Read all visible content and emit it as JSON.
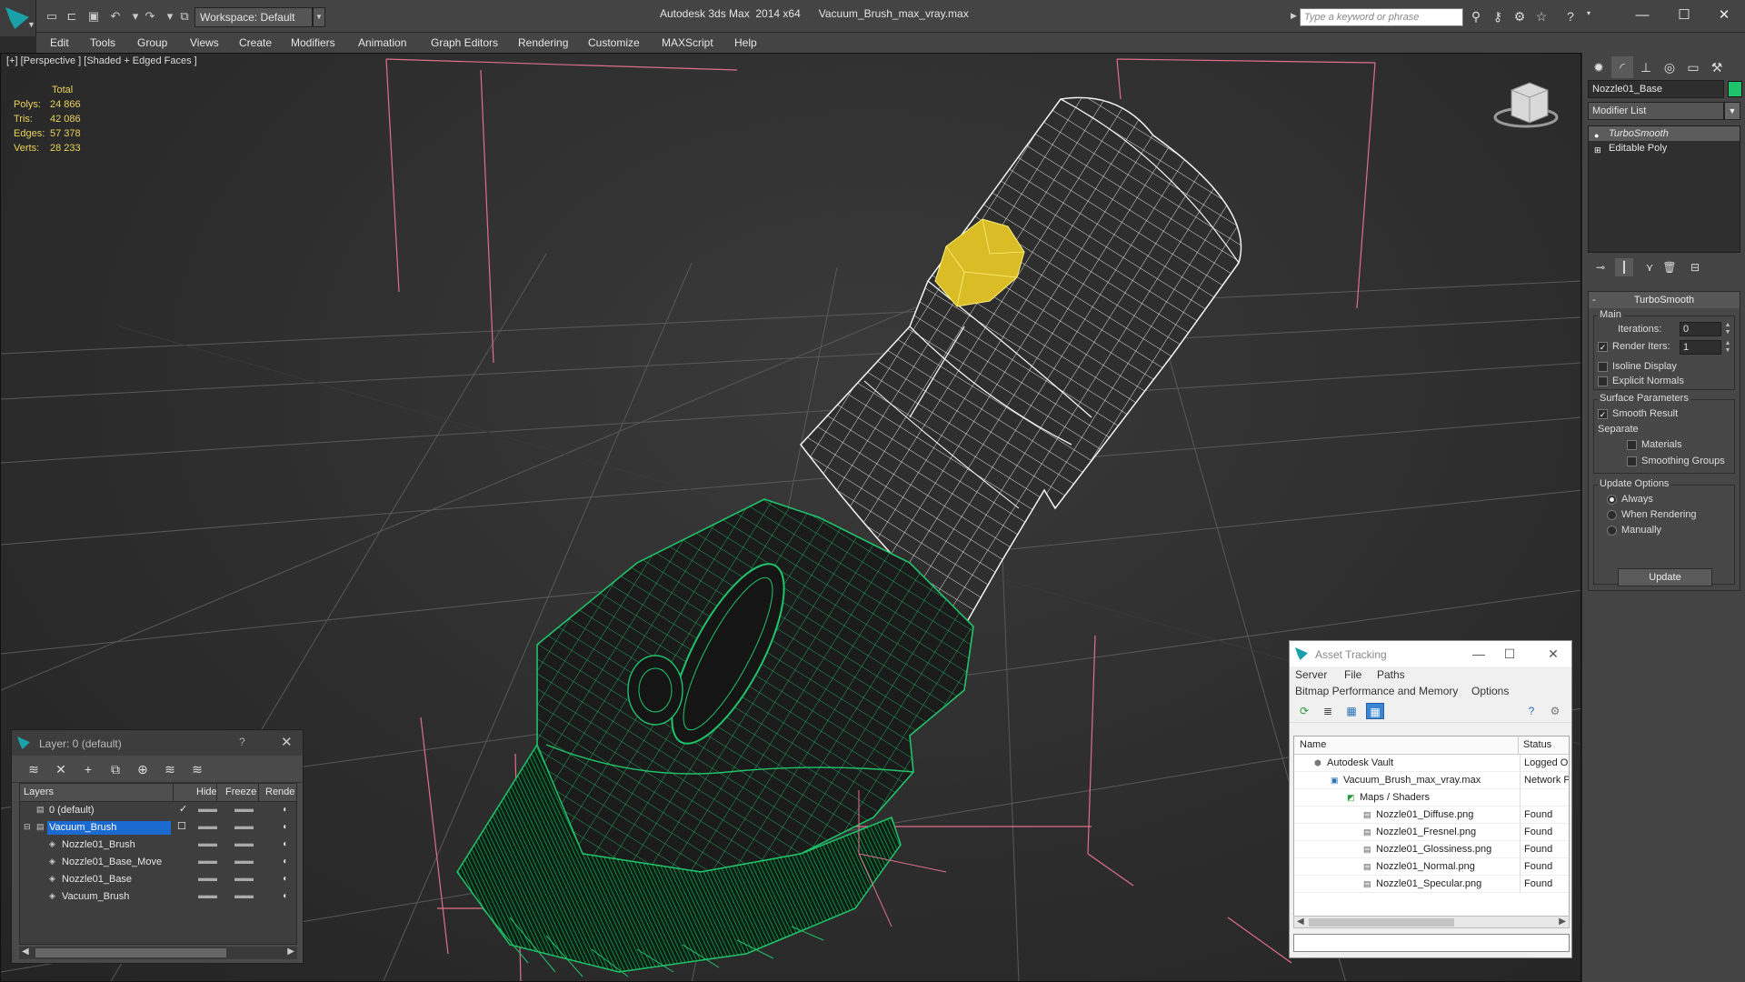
{
  "titlebar": {
    "workspace": "Workspace: Default",
    "title": "Autodesk 3ds Max  2014 x64      Vacuum_Brush_max_vray.max",
    "search_placeholder": "Type a keyword or phrase"
  },
  "menu": [
    "Edit",
    "Tools",
    "Group",
    "Views",
    "Create",
    "Modifiers",
    "Animation",
    "Graph Editors",
    "Rendering",
    "Customize",
    "MAXScript",
    "Help"
  ],
  "viewport": {
    "label": "[+] [Perspective ] [Shaded + Edged Faces ]",
    "stats": {
      "total_label": "Total",
      "rows": [
        {
          "label": "Polys:",
          "value": "24 866"
        },
        {
          "label": "Tris:",
          "value": "42 086"
        },
        {
          "label": "Edges:",
          "value": "57 378"
        },
        {
          "label": "Verts:",
          "value": "28 233"
        }
      ]
    },
    "colors": {
      "brush_wire": "#1fc36a",
      "knob": "#e0c22a",
      "grid": "#595959",
      "frame": "#e0708a"
    }
  },
  "command_panel": {
    "object_name": "Nozzle01_Base",
    "object_color": "#1fc36a",
    "modifier_list": "Modifier List",
    "stack": [
      "TurboSmooth",
      "Editable Poly"
    ],
    "turbosmooth": {
      "title": "TurboSmooth",
      "main_group": "Main",
      "iterations_label": "Iterations:",
      "iterations_value": "0",
      "render_iters_label": "Render Iters:",
      "render_iters_value": "1",
      "isoline_label": "Isoline Display",
      "explicit_normals_label": "Explicit Normals",
      "surface_group": "Surface Parameters",
      "smooth_result_label": "Smooth Result",
      "separate_label": "Separate",
      "materials_label": "Materials",
      "smoothing_groups_label": "Smoothing Groups",
      "update_group": "Update Options",
      "always_label": "Always",
      "when_rendering_label": "When Rendering",
      "manually_label": "Manually",
      "update_button": "Update"
    }
  },
  "layer_explorer": {
    "title": "Layer: 0 (default)",
    "help": "?",
    "columns": [
      "Layers",
      "Hide",
      "Freeze",
      "Rende"
    ],
    "rows": [
      {
        "name": "0 (default)",
        "indent": 0
      },
      {
        "name": "Vacuum_Brush",
        "indent": 0
      },
      {
        "name": "Nozzle01_Brush",
        "indent": 1
      },
      {
        "name": "Nozzle01_Base_Move",
        "indent": 1
      },
      {
        "name": "Nozzle01_Base",
        "indent": 1
      },
      {
        "name": "Vacuum_Brush",
        "indent": 1
      }
    ]
  },
  "asset_tracking": {
    "title": "Asset Tracking",
    "menu1": [
      "Server",
      "File",
      "Paths"
    ],
    "menu2": [
      "Bitmap Performance and Memory",
      "Options"
    ],
    "columns": [
      "Name",
      "Status"
    ],
    "rows": [
      {
        "name": "Autodesk Vault",
        "status": "Logged Ou"
      },
      {
        "name": "Vacuum_Brush_max_vray.max",
        "status": "Network P"
      },
      {
        "name": "Maps / Shaders",
        "status": ""
      },
      {
        "name": "Nozzle01_Diffuse.png",
        "status": "Found"
      },
      {
        "name": "Nozzle01_Fresnel.png",
        "status": "Found"
      },
      {
        "name": "Nozzle01_Glossiness.png",
        "status": "Found"
      },
      {
        "name": "Nozzle01_Normal.png",
        "status": "Found"
      },
      {
        "name": "Nozzle01_Specular.png",
        "status": "Found"
      }
    ]
  }
}
